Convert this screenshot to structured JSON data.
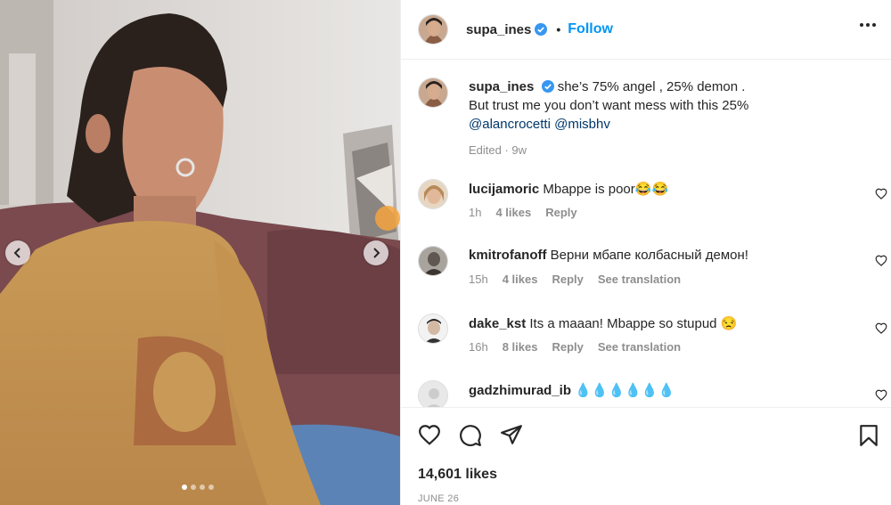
{
  "post": {
    "author": "supa_ines",
    "follow_label": "Follow",
    "separator": "•"
  },
  "caption": {
    "username": "supa_ines",
    "text_line1": "she’s 75% angel , 25% demon .",
    "text_line2": "But trust me you don’t want mess with this 25%",
    "mention1": "@alancrocetti",
    "mention2": "@misbhv",
    "meta": "Edited · 9w"
  },
  "comments": [
    {
      "username": "lucijamoric",
      "text": "Mbappe is poor😂😂",
      "time": "1h",
      "likes": "4 likes",
      "reply": "Reply",
      "translate": ""
    },
    {
      "username": "kmitrofanoff",
      "text": "Верни мбапе колбасный демон!",
      "time": "15h",
      "likes": "4 likes",
      "reply": "Reply",
      "translate": "See translation"
    },
    {
      "username": "dake_kst",
      "text": "Its a maaan! Mbappe so stupud 😒",
      "time": "16h",
      "likes": "8 likes",
      "reply": "Reply",
      "translate": "See translation"
    },
    {
      "username": "gadzhimurad_ib",
      "text": "💧💧💧💧💧💧",
      "time": "",
      "likes": "",
      "reply": "",
      "translate": ""
    }
  ],
  "footer": {
    "likes": "14,601 likes",
    "date": "JUNE 26"
  },
  "carousel": {
    "slide_count": 4,
    "active_index": 0
  },
  "colors": {
    "accent": "#0095f6",
    "verified": "#3897f0",
    "mention": "#00376b",
    "muted": "#8e8e8e"
  },
  "icons": [
    "chevron-left-icon",
    "chevron-right-icon",
    "verified-badge-icon",
    "more-options-icon",
    "heart-icon",
    "comment-icon",
    "share-icon",
    "bookmark-icon"
  ]
}
